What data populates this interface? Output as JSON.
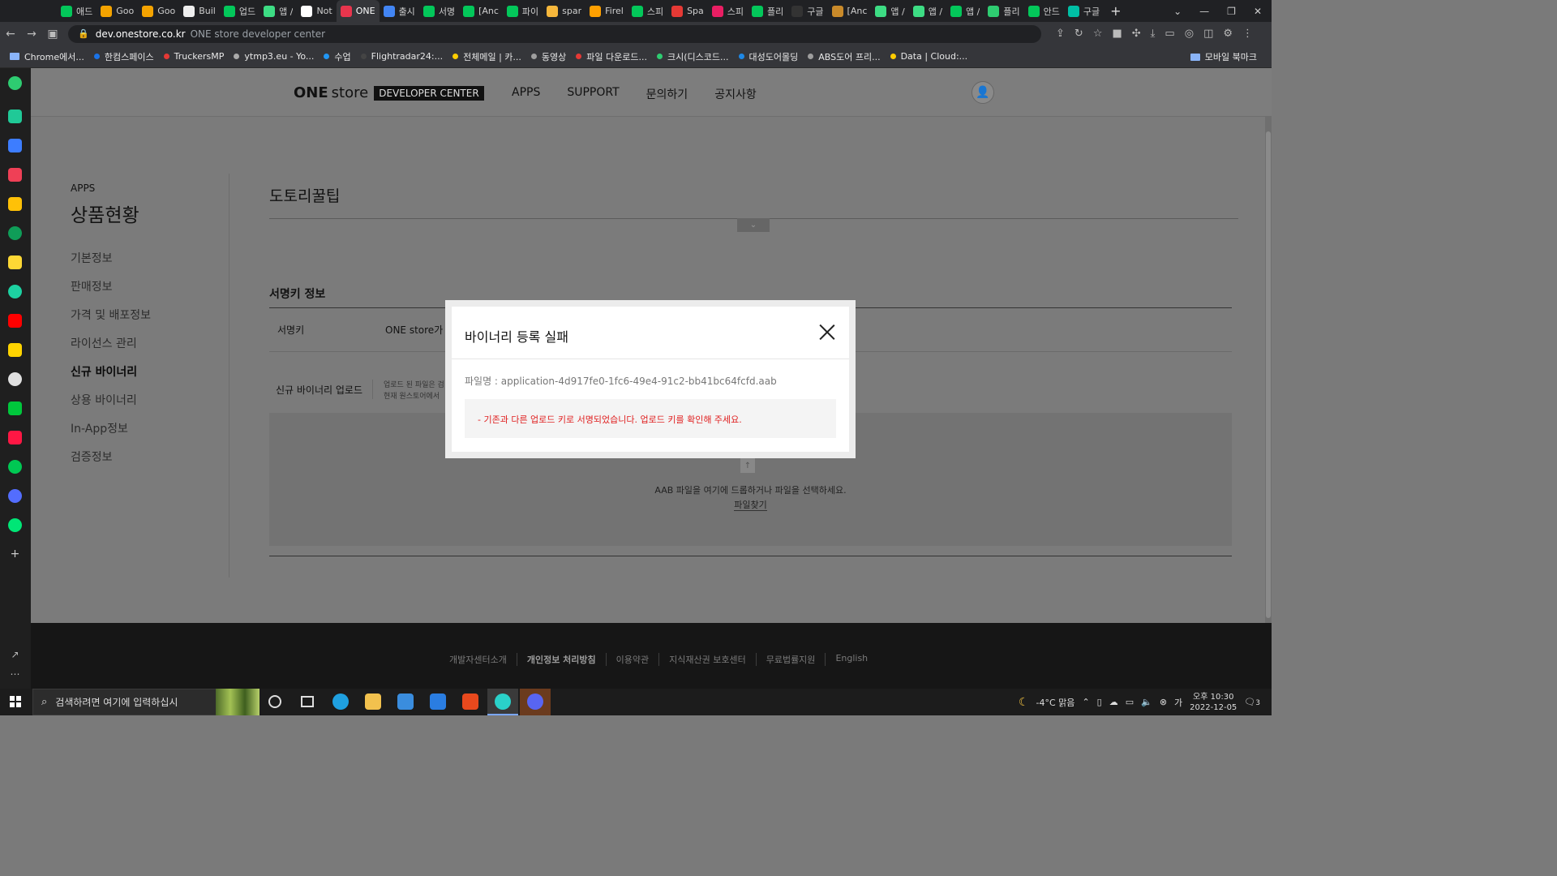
{
  "browser": {
    "tabs": [
      {
        "label": "애드",
        "color": "#03c75a"
      },
      {
        "label": "Goo",
        "color": "#f4a300"
      },
      {
        "label": "Goo",
        "color": "#f4a300"
      },
      {
        "label": "Buil",
        "color": "#eeeeee"
      },
      {
        "label": "업드",
        "color": "#03c75a"
      },
      {
        "label": "앱 /",
        "color": "#3ddc84"
      },
      {
        "label": "Not",
        "color": "#ffffff"
      },
      {
        "label": "ONE",
        "color": "#e8354d"
      },
      {
        "label": "출시",
        "color": "#4285f4"
      },
      {
        "label": "서명",
        "color": "#03c75a"
      },
      {
        "label": "[Anc",
        "color": "#03c75a"
      },
      {
        "label": "파이",
        "color": "#03c75a"
      },
      {
        "label": "spar",
        "color": "#f6b73c"
      },
      {
        "label": "Firel",
        "color": "#ffa000"
      },
      {
        "label": "스피",
        "color": "#03c75a"
      },
      {
        "label": "Spa",
        "color": "#e53935"
      },
      {
        "label": "스피",
        "color": "#e91e63"
      },
      {
        "label": "플리",
        "color": "#03c75a"
      },
      {
        "label": "구글",
        "color": "#333333"
      },
      {
        "label": "[Anc",
        "color": "#c98a2a"
      },
      {
        "label": "앱 /",
        "color": "#3ddc84"
      },
      {
        "label": "앱 /",
        "color": "#3ddc84"
      },
      {
        "label": "앱 /",
        "color": "#03c75a"
      },
      {
        "label": "플리",
        "color": "#2ecc71"
      },
      {
        "label": "안드",
        "color": "#03c75a"
      },
      {
        "label": "구글",
        "color": "#00bfa5"
      }
    ],
    "active_tab_index": 7,
    "url_host": "dev.onestore.co.kr",
    "url_title": "ONE store developer center",
    "bookmarks": [
      {
        "label": "Chrome에서...",
        "color": "#8ab4f8",
        "folder": true
      },
      {
        "label": "한컴스페이스",
        "color": "#1a73e8"
      },
      {
        "label": "TruckersMP",
        "color": "#e53935"
      },
      {
        "label": "ytmp3.eu - Yo...",
        "color": "#aaaaaa"
      },
      {
        "label": "수업",
        "color": "#2196f3"
      },
      {
        "label": "Flightradar24:...",
        "color": "#444444"
      },
      {
        "label": "전체메일 | 카...",
        "color": "#ffcd00"
      },
      {
        "label": "동영상",
        "color": "#9e9e9e"
      },
      {
        "label": "파일 다운로드...",
        "color": "#e53935"
      },
      {
        "label": "크시(디스코드...",
        "color": "#2ecc71"
      },
      {
        "label": "대성도어몰딩",
        "color": "#1e88e5"
      },
      {
        "label": "ABS도어 프리...",
        "color": "#9e9e9e"
      },
      {
        "label": "Data | Cloud:...",
        "color": "#ffcc00"
      }
    ],
    "bookmarks_right": "모바일 북마크"
  },
  "header": {
    "logo_one": "ONE",
    "logo_store": "store",
    "logo_badge": "DEVELOPER CENTER",
    "nav": [
      "APPS",
      "SUPPORT",
      "문의하기",
      "공지사항"
    ]
  },
  "lnb": {
    "section": "APPS",
    "title": "상품현황",
    "items": [
      "기본정보",
      "판매정보",
      "가격 및 배포정보",
      "라이선스 관리",
      "신규 바이너리",
      "상용 바이너리",
      "In-App정보",
      "검증정보"
    ],
    "active_index": 4
  },
  "content": {
    "title": "도토리꿀팁",
    "section_title": "서명키 정보",
    "sign_key_label": "서명키",
    "sign_key_value": "ONE store가 '",
    "upload_label": "신규 바이너리 업로드",
    "upload_note_1": "업로드 된 파일은 검",
    "upload_note_2": "현재 원스토어에서",
    "drop_hint": "AAB 파일을 여기에 드롭하거나 파일을 선택하세요.",
    "find_file": "파일찾기"
  },
  "footer": {
    "links": [
      "개발자센터소개",
      "개인정보 처리방침",
      "이용약관",
      "지식재산권 보호센터",
      "무료법률지원",
      "English"
    ],
    "bold_index": 1
  },
  "modal": {
    "title": "바이너리 등록 실패",
    "file_name": "파일명 : application-4d917fe0-1fc6-49e4-91c2-bb41bc64fcfd.aab",
    "error_message": "- 기존과 다른 업로드 키로 서명되었습니다. 업로드 키를 확인해 주세요."
  },
  "taskbar": {
    "search_placeholder": "검색하려면 여기에 입력하십시",
    "weather": "-4°C  맑음",
    "time": "오후 10:30",
    "date": "2022-12-05",
    "notifications": "3"
  }
}
